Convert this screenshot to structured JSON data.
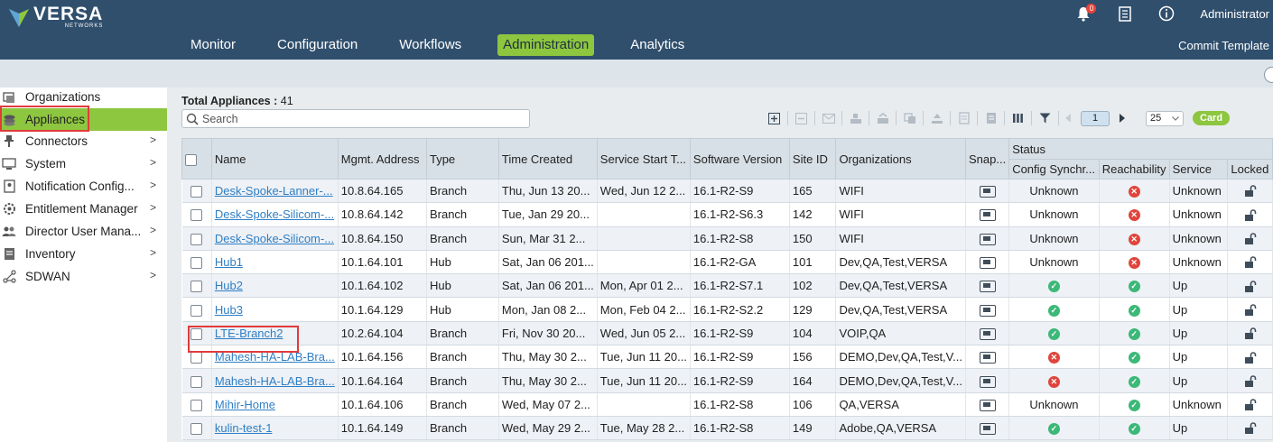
{
  "brand": {
    "name": "VERSA",
    "sub": "NETWORKS"
  },
  "header": {
    "notification_count": "0",
    "user": "Administrator",
    "commit": "Commit Template",
    "nav": [
      "Monitor",
      "Configuration",
      "Workflows",
      "Administration",
      "Analytics"
    ],
    "active_nav": "Administration"
  },
  "sidebar": {
    "items": [
      {
        "label": "Organizations",
        "icon": "organizations-icon",
        "chevron": false
      },
      {
        "label": "Appliances",
        "icon": "appliances-icon",
        "chevron": false,
        "active": true
      },
      {
        "label": "Connectors",
        "icon": "connectors-icon",
        "chevron": true
      },
      {
        "label": "System",
        "icon": "system-icon",
        "chevron": true
      },
      {
        "label": "Notification Config...",
        "icon": "notification-icon",
        "chevron": true
      },
      {
        "label": "Entitlement Manager",
        "icon": "gear-icon",
        "chevron": true
      },
      {
        "label": "Director User Mana...",
        "icon": "users-icon",
        "chevron": true
      },
      {
        "label": "Inventory",
        "icon": "inventory-icon",
        "chevron": true
      },
      {
        "label": "SDWAN",
        "icon": "sdwan-icon",
        "chevron": true
      }
    ]
  },
  "appliances": {
    "total_label": "Total Appliances :",
    "total_count": "41",
    "search_placeholder": "Search",
    "page": "1",
    "page_size": "25",
    "card_label": "Card",
    "status_group": "Status",
    "columns": [
      "Name",
      "Mgmt. Address",
      "Type",
      "Time Created",
      "Service Start T...",
      "Software Version",
      "Site ID",
      "Organizations",
      "Snap...",
      "Config Synchr...",
      "Reachability",
      "Service",
      "Locked"
    ],
    "rows": [
      {
        "name": "Desk-Spoke-Lanner-...",
        "mgmt": "10.8.64.165",
        "type": "Branch",
        "created": "Thu, Jun 13 20...",
        "start": "Wed, Jun 12 2...",
        "version": "16.1-R2-S9",
        "site": "165",
        "orgs": "WIFI",
        "config": "Unknown",
        "reach": "bad",
        "service": "Unknown"
      },
      {
        "name": "Desk-Spoke-Silicom-...",
        "mgmt": "10.8.64.142",
        "type": "Branch",
        "created": "Tue, Jan 29 20...",
        "start": "",
        "version": "16.1-R2-S6.3",
        "site": "142",
        "orgs": "WIFI",
        "config": "Unknown",
        "reach": "bad",
        "service": "Unknown"
      },
      {
        "name": "Desk-Spoke-Silicom-...",
        "mgmt": "10.8.64.150",
        "type": "Branch",
        "created": "Sun, Mar 31 2...",
        "start": "",
        "version": "16.1-R2-S8",
        "site": "150",
        "orgs": "WIFI",
        "config": "Unknown",
        "reach": "bad",
        "service": "Unknown"
      },
      {
        "name": "Hub1",
        "mgmt": "10.1.64.101",
        "type": "Hub",
        "created": "Sat, Jan 06 201...",
        "start": "",
        "version": "16.1-R2-GA",
        "site": "101",
        "orgs": "Dev,QA,Test,VERSA",
        "config": "Unknown",
        "reach": "bad",
        "service": "Unknown"
      },
      {
        "name": "Hub2",
        "mgmt": "10.1.64.102",
        "type": "Hub",
        "created": "Sat, Jan 06 201...",
        "start": "Mon, Apr 01 2...",
        "version": "16.1-R2-S7.1",
        "site": "102",
        "orgs": "Dev,QA,Test,VERSA",
        "config": "ok",
        "reach": "ok",
        "service": "Up"
      },
      {
        "name": "Hub3",
        "mgmt": "10.1.64.129",
        "type": "Hub",
        "created": "Mon, Jan 08 2...",
        "start": "Mon, Feb 04 2...",
        "version": "16.1-R2-S2.2",
        "site": "129",
        "orgs": "Dev,QA,Test,VERSA",
        "config": "ok",
        "reach": "ok",
        "service": "Up"
      },
      {
        "name": "LTE-Branch2",
        "mgmt": "10.2.64.104",
        "type": "Branch",
        "created": "Fri, Nov 30 20...",
        "start": "Wed, Jun 05 2...",
        "version": "16.1-R2-S9",
        "site": "104",
        "orgs": "VOIP,QA",
        "config": "ok",
        "reach": "ok",
        "service": "Up"
      },
      {
        "name": "Mahesh-HA-LAB-Bra...",
        "mgmt": "10.1.64.156",
        "type": "Branch",
        "created": "Thu, May 30 2...",
        "start": "Tue, Jun 11 20...",
        "version": "16.1-R2-S9",
        "site": "156",
        "orgs": "DEMO,Dev,QA,Test,V...",
        "config": "bad",
        "reach": "ok",
        "service": "Up"
      },
      {
        "name": "Mahesh-HA-LAB-Bra...",
        "mgmt": "10.1.64.164",
        "type": "Branch",
        "created": "Thu, May 30 2...",
        "start": "Tue, Jun 11 20...",
        "version": "16.1-R2-S9",
        "site": "164",
        "orgs": "DEMO,Dev,QA,Test,V...",
        "config": "bad",
        "reach": "ok",
        "service": "Up"
      },
      {
        "name": "Mihir-Home",
        "mgmt": "10.1.64.106",
        "type": "Branch",
        "created": "Wed, May 07 2...",
        "start": "",
        "version": "16.1-R2-S8",
        "site": "106",
        "orgs": "QA,VERSA",
        "config": "Unknown",
        "reach": "ok",
        "service": "Unknown"
      },
      {
        "name": "kulin-test-1",
        "mgmt": "10.1.64.149",
        "type": "Branch",
        "created": "Wed, May 29 2...",
        "start": "Tue, May 28 2...",
        "version": "16.1-R2-S8",
        "site": "149",
        "orgs": "Adobe,QA,VERSA",
        "config": "ok",
        "reach": "ok",
        "service": "Up"
      }
    ]
  },
  "colors": {
    "header_bg": "#304f6d",
    "accent": "#8dc63f",
    "link": "#2f7fc4",
    "ok": "#3cb878",
    "bad": "#e0443c",
    "highlight_box": "#e03b3b"
  }
}
